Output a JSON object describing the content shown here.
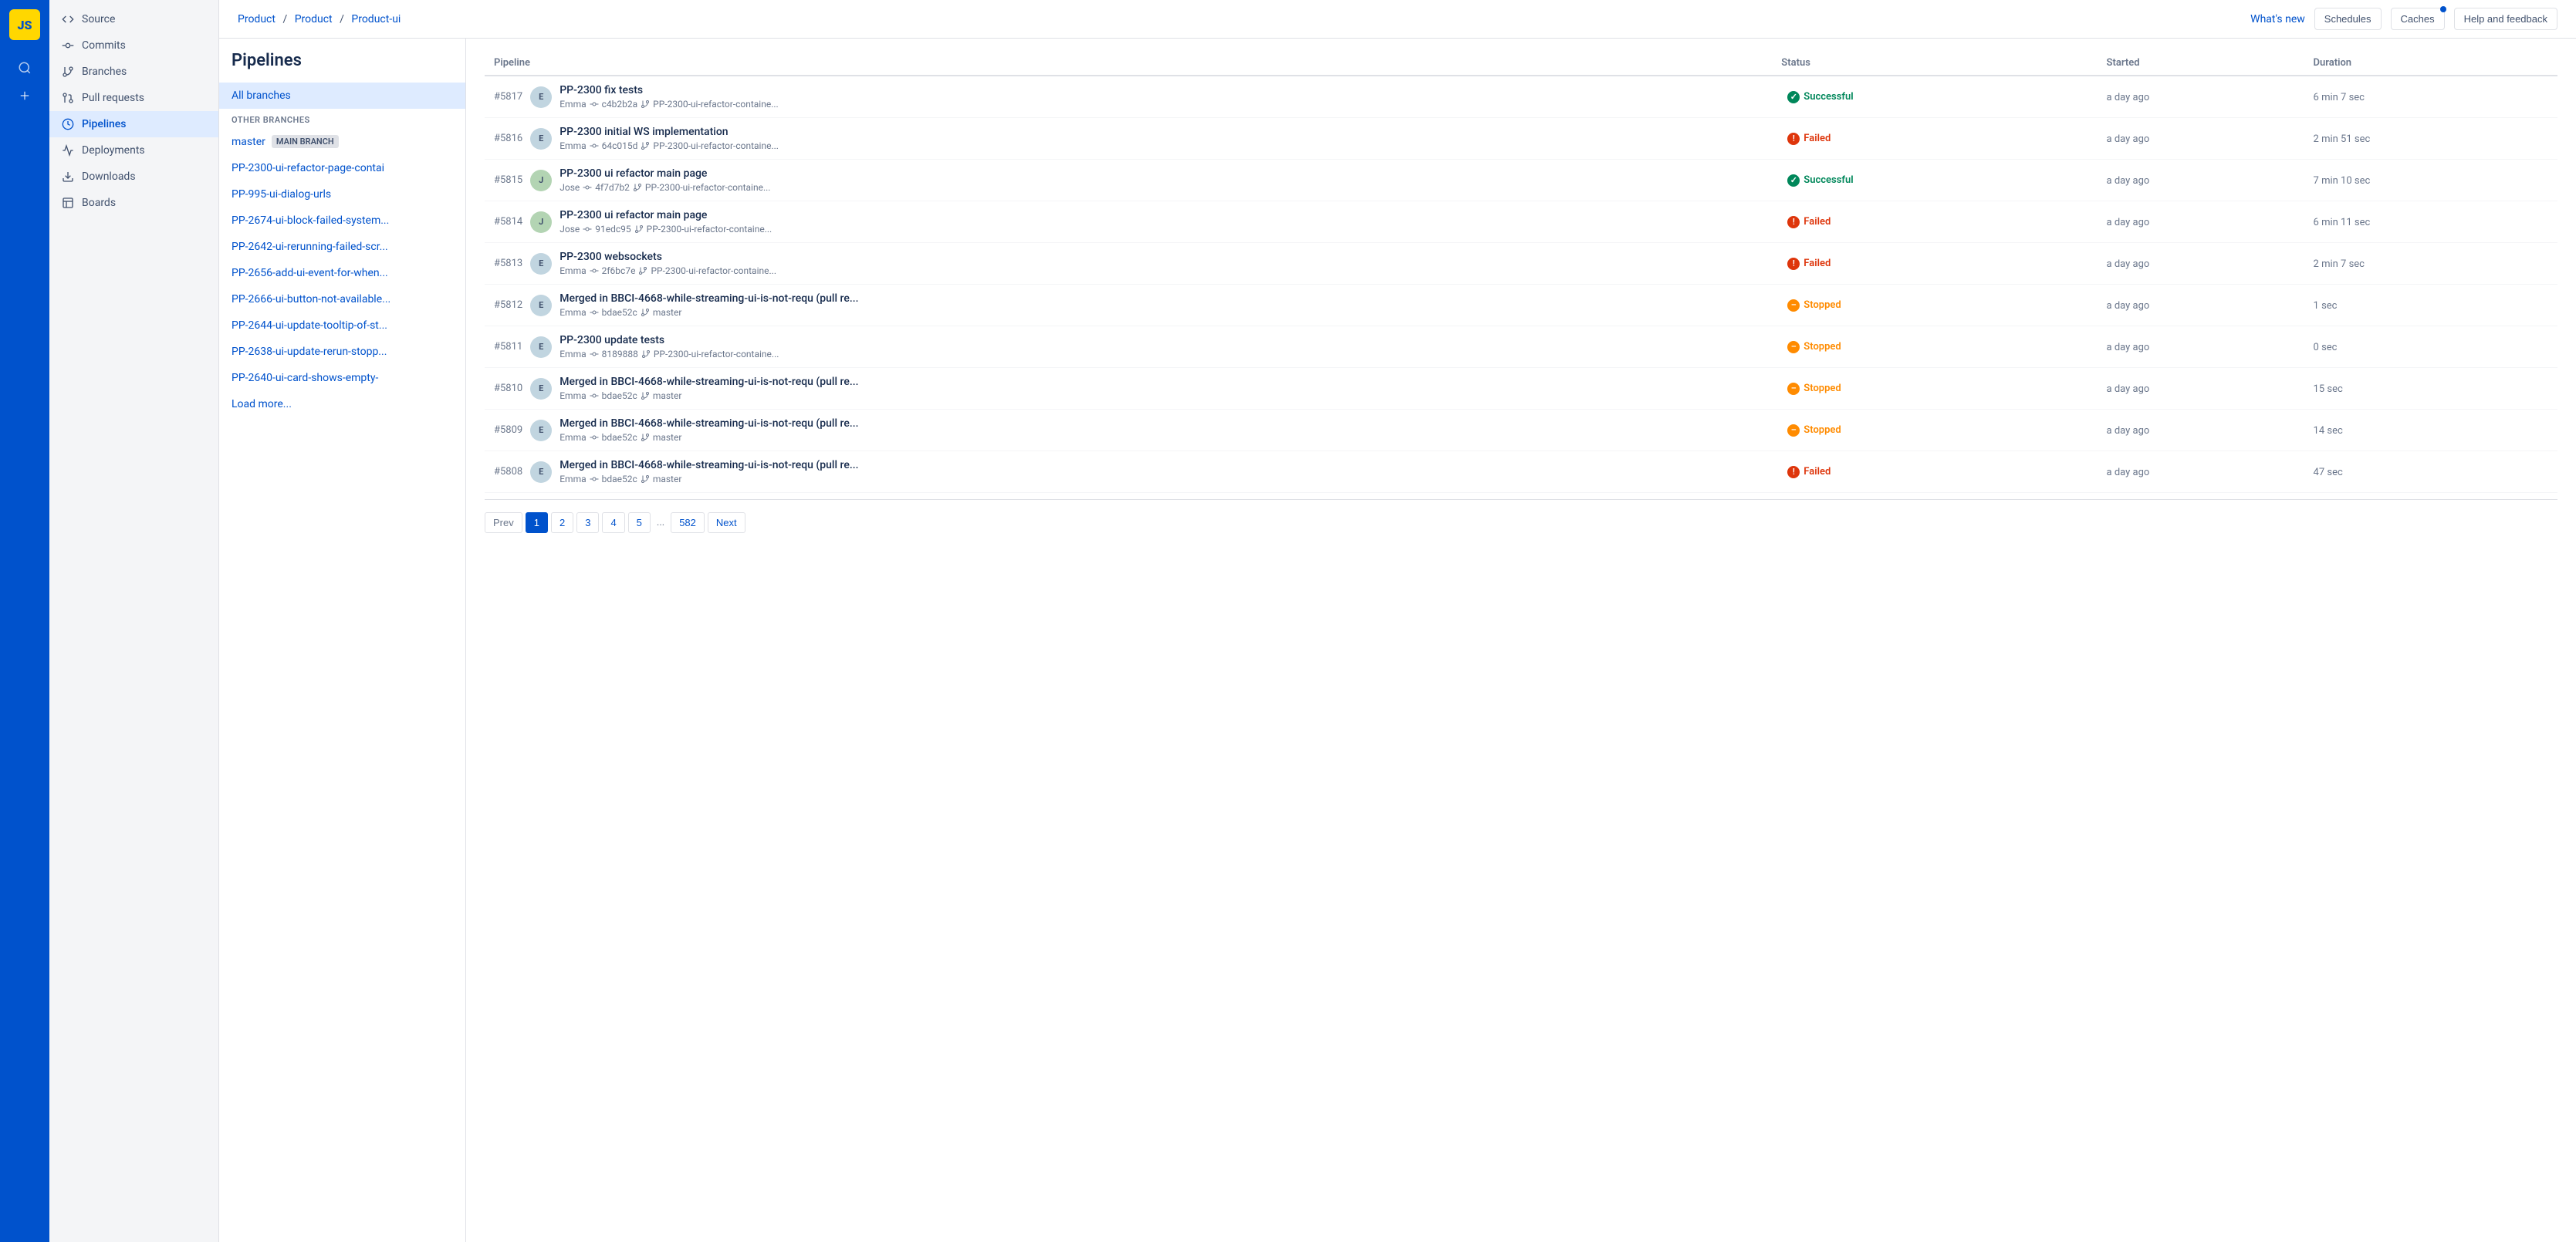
{
  "logo": {
    "text": "JS"
  },
  "breadcrumb": {
    "parts": [
      "Product",
      "Product",
      "Product-ui"
    ],
    "separators": [
      "/",
      "/"
    ]
  },
  "header": {
    "whats_new": "What's new",
    "schedules": "Schedules",
    "caches": "Caches",
    "help": "Help and feedback"
  },
  "page": {
    "title": "Pipelines"
  },
  "sidebar_nav": [
    {
      "id": "source",
      "label": "Source",
      "icon": "code"
    },
    {
      "id": "commits",
      "label": "Commits",
      "icon": "commits"
    },
    {
      "id": "branches",
      "label": "Branches",
      "icon": "branches"
    },
    {
      "id": "pull-requests",
      "label": "Pull requests",
      "icon": "pr"
    },
    {
      "id": "pipelines",
      "label": "Pipelines",
      "icon": "pipelines",
      "active": true
    },
    {
      "id": "deployments",
      "label": "Deployments",
      "icon": "deployments"
    },
    {
      "id": "downloads",
      "label": "Downloads",
      "icon": "downloads"
    },
    {
      "id": "boards",
      "label": "Boards",
      "icon": "boards"
    }
  ],
  "branches": {
    "all_branches_label": "All branches",
    "other_label": "OTHER BRANCHES",
    "master_label": "master",
    "master_badge": "MAIN BRANCH",
    "items": [
      "PP-2300-ui-refactor-page-contai",
      "PP-995-ui-dialog-urls",
      "PP-2674-ui-block-failed-system...",
      "PP-2642-ui-rerunning-failed-scr...",
      "PP-2656-add-ui-event-for-when...",
      "PP-2666-ui-button-not-available...",
      "PP-2644-ui-update-tooltip-of-st...",
      "PP-2638-ui-update-rerun-stopp...",
      "PP-2640-ui-card-shows-empty-"
    ],
    "load_more": "Load more..."
  },
  "table": {
    "columns": [
      "Pipeline",
      "Status",
      "Started",
      "Duration"
    ],
    "rows": [
      {
        "num": "#5817",
        "avatar_initials": "E",
        "avatar_class": "avatar-emma",
        "title": "PP-2300 fix tests",
        "author": "Emma",
        "commit": "c4b2b2a",
        "branch": "PP-2300-ui-refactor-containe...",
        "status": "Successful",
        "status_class": "status-successful",
        "icon_class": "icon-success",
        "icon_symbol": "✓",
        "started": "a day ago",
        "duration": "6 min 7 sec"
      },
      {
        "num": "#5816",
        "avatar_initials": "E",
        "avatar_class": "avatar-emma",
        "title": "PP-2300 initial WS implementation",
        "author": "Emma",
        "commit": "64c015d",
        "branch": "PP-2300-ui-refactor-containe...",
        "status": "Failed",
        "status_class": "status-failed",
        "icon_class": "icon-failed",
        "icon_symbol": "!",
        "started": "a day ago",
        "duration": "2 min 51 sec"
      },
      {
        "num": "#5815",
        "avatar_initials": "J",
        "avatar_class": "avatar-jose",
        "title": "PP-2300 ui refactor main page",
        "author": "Jose",
        "commit": "4f7d7b2",
        "branch": "PP-2300-ui-refactor-containe...",
        "status": "Successful",
        "status_class": "status-successful",
        "icon_class": "icon-success",
        "icon_symbol": "✓",
        "started": "a day ago",
        "duration": "7 min 10 sec"
      },
      {
        "num": "#5814",
        "avatar_initials": "J",
        "avatar_class": "avatar-jose",
        "title": "PP-2300 ui refactor main page",
        "author": "Jose",
        "commit": "91edc95",
        "branch": "PP-2300-ui-refactor-containe...",
        "status": "Failed",
        "status_class": "status-failed",
        "icon_class": "icon-failed",
        "icon_symbol": "!",
        "started": "a day ago",
        "duration": "6 min 11 sec"
      },
      {
        "num": "#5813",
        "avatar_initials": "E",
        "avatar_class": "avatar-emma",
        "title": "PP-2300 websockets",
        "author": "Emma",
        "commit": "2f6bc7e",
        "branch": "PP-2300-ui-refactor-containe...",
        "status": "Failed",
        "status_class": "status-failed",
        "icon_class": "icon-failed",
        "icon_symbol": "!",
        "started": "a day ago",
        "duration": "2 min 7 sec"
      },
      {
        "num": "#5812",
        "avatar_initials": "E",
        "avatar_class": "avatar-emma",
        "title": "Merged in BBCI-4668-while-streaming-ui-is-not-requ (pull re...",
        "author": "Emma",
        "commit": "bdae52c",
        "branch": "master",
        "status": "Stopped",
        "status_class": "status-stopped",
        "icon_class": "icon-stopped",
        "icon_symbol": "–",
        "started": "a day ago",
        "duration": "1 sec"
      },
      {
        "num": "#5811",
        "avatar_initials": "E",
        "avatar_class": "avatar-emma",
        "title": "PP-2300 update tests",
        "author": "Emma",
        "commit": "8189888",
        "branch": "PP-2300-ui-refactor-containe...",
        "status": "Stopped",
        "status_class": "status-stopped",
        "icon_class": "icon-stopped",
        "icon_symbol": "–",
        "started": "a day ago",
        "duration": "0 sec"
      },
      {
        "num": "#5810",
        "avatar_initials": "E",
        "avatar_class": "avatar-emma",
        "title": "Merged in BBCI-4668-while-streaming-ui-is-not-requ (pull re...",
        "author": "Emma",
        "commit": "bdae52c",
        "branch": "master",
        "status": "Stopped",
        "status_class": "status-stopped",
        "icon_class": "icon-stopped",
        "icon_symbol": "–",
        "started": "a day ago",
        "duration": "15 sec"
      },
      {
        "num": "#5809",
        "avatar_initials": "E",
        "avatar_class": "avatar-emma",
        "title": "Merged in BBCI-4668-while-streaming-ui-is-not-requ (pull re...",
        "author": "Emma",
        "commit": "bdae52c",
        "branch": "master",
        "status": "Stopped",
        "status_class": "status-stopped",
        "icon_class": "icon-stopped",
        "icon_symbol": "–",
        "started": "a day ago",
        "duration": "14 sec"
      },
      {
        "num": "#5808",
        "avatar_initials": "E",
        "avatar_class": "avatar-emma",
        "title": "Merged in BBCI-4668-while-streaming-ui-is-not-requ (pull re...",
        "author": "Emma",
        "commit": "bdae52c",
        "branch": "master",
        "status": "Failed",
        "status_class": "status-failed",
        "icon_class": "icon-failed",
        "icon_symbol": "!",
        "started": "a day ago",
        "duration": "47 sec"
      }
    ]
  },
  "pagination": {
    "prev": "Prev",
    "next": "Next",
    "pages": [
      "1",
      "2",
      "3",
      "4",
      "5"
    ],
    "dots": "...",
    "last": "582"
  }
}
